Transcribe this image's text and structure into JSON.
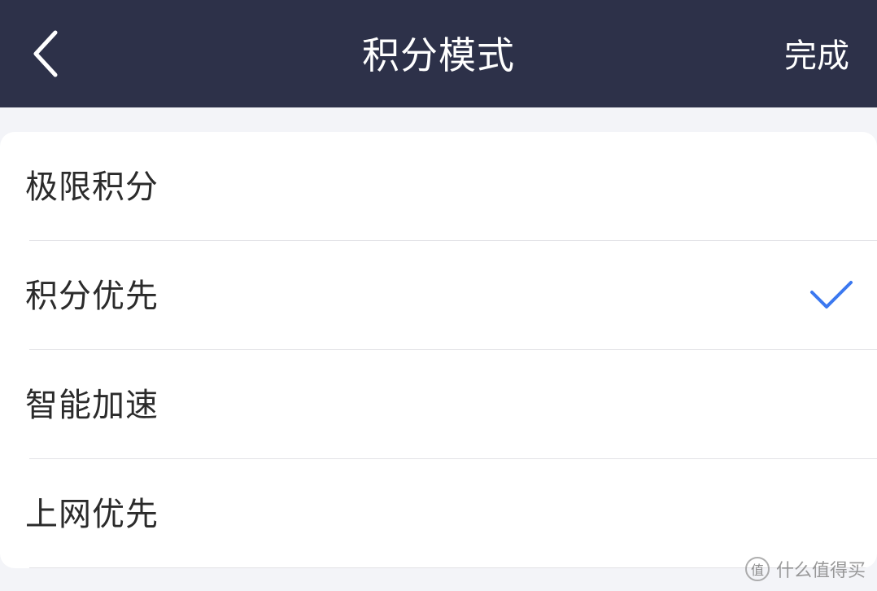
{
  "header": {
    "title": "积分模式",
    "done_label": "完成",
    "back_icon": "chevron-left-icon"
  },
  "options": [
    {
      "label": "极限积分",
      "selected": false
    },
    {
      "label": "积分优先",
      "selected": true
    },
    {
      "label": "智能加速",
      "selected": false
    },
    {
      "label": "上网优先",
      "selected": false
    }
  ],
  "colors": {
    "header_bg": "#2d3149",
    "page_bg": "#f3f4f8",
    "check": "#3b78f0",
    "text": "#2b2b2b"
  },
  "watermark": {
    "logo_char": "值",
    "text": "什么值得买"
  }
}
